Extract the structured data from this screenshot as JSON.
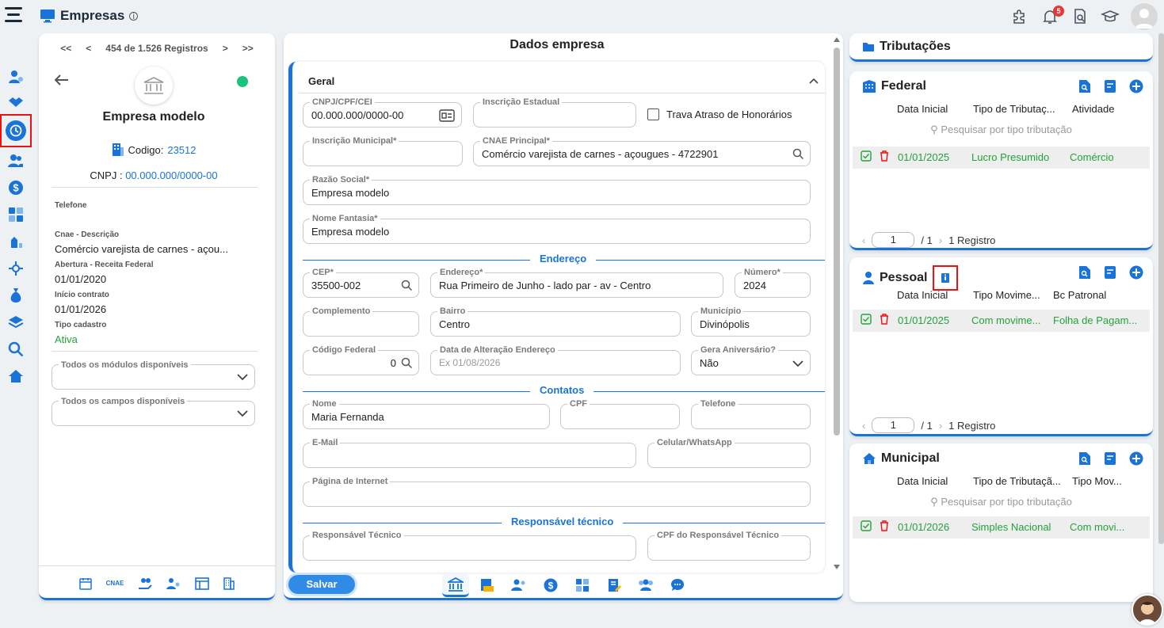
{
  "app": {
    "title": "Empresas",
    "notification_count": "5"
  },
  "left": {
    "nav": {
      "first": "<<",
      "prev": "<",
      "counter": "454 de 1.526 Registros",
      "next": ">",
      "last": ">>"
    },
    "company_name": "Empresa modelo",
    "codigo_label": "Codigo:",
    "codigo_value": "23512",
    "cnpj_label": "CNPJ :",
    "cnpj_value": "00.000.000/0000-00",
    "telefone_label": "Telefone",
    "cnae_label": "Cnae - Descrição",
    "cnae_value": "Comércio varejista de carnes - açou...",
    "abertura_label": "Abertura - Receita Federal",
    "abertura_value": "01/01/2020",
    "inicio_label": "Início contrato",
    "inicio_value": "01/01/2026",
    "tipo_label": "Tipo cadastro",
    "tipo_value": "Ativa",
    "modulos_label": "Todos os módulos disponíveis",
    "campos_label": "Todos os campos disponíveis",
    "cnae_icon_text": "CNAE"
  },
  "center": {
    "title": "Dados empresa",
    "geral": "Geral",
    "cnpj": {
      "label": "CNPJ/CPF/CEI",
      "value": "00.000.000/0000-00"
    },
    "ie": {
      "label": "Inscrição Estadual",
      "value": ""
    },
    "trava": "Trava Atraso de Honorários",
    "im": {
      "label": "Inscrição Municipal*",
      "value": ""
    },
    "cnae": {
      "label": "CNAE Principal*",
      "value": "Comércio varejista de carnes - açougues - 4722901"
    },
    "razao": {
      "label": "Razão Social*",
      "value": "Empresa modelo"
    },
    "fantasia": {
      "label": "Nome Fantasia*",
      "value": "Empresa modelo"
    },
    "endereco_sec": "Endereço",
    "cep": {
      "label": "CEP*",
      "value": "35500-002"
    },
    "endereco": {
      "label": "Endereço*",
      "value": "Rua Primeiro de Junho - lado par - av - Centro"
    },
    "numero": {
      "label": "Número*",
      "value": "2024"
    },
    "complemento": {
      "label": "Complemento",
      "value": ""
    },
    "bairro": {
      "label": "Bairro",
      "value": "Centro"
    },
    "municipio": {
      "label": "Município",
      "value": "Divinópolis"
    },
    "codfed": {
      "label": "Código Federal",
      "value": "0"
    },
    "dataalt": {
      "label": "Data de Alteração Endereço",
      "placeholder": "Ex 01/08/2026"
    },
    "aniv": {
      "label": "Gera Aniversário?",
      "value": "Não"
    },
    "contatos_sec": "Contatos",
    "nome": {
      "label": "Nome",
      "value": "Maria Fernanda"
    },
    "cpf": {
      "label": "CPF",
      "value": ""
    },
    "telefone": {
      "label": "Telefone",
      "value": ""
    },
    "email": {
      "label": "E-Mail",
      "value": ""
    },
    "celular": {
      "label": "Celular/WhatsApp",
      "value": ""
    },
    "pagina": {
      "label": "Página de Internet",
      "value": ""
    },
    "resp_sec": "Responsável técnico",
    "resp": {
      "label": "Responsável Técnico",
      "value": ""
    },
    "cpfresp": {
      "label": "CPF do Responsável Técnico",
      "value": ""
    },
    "salvar": "Salvar"
  },
  "right": {
    "title": "Tributações",
    "federal": {
      "title": "Federal",
      "cols": [
        "Data Inicial",
        "Tipo de Tributaç...",
        "Atividade"
      ],
      "search": "Pesquisar por tipo tributação",
      "row": [
        "01/01/2025",
        "Lucro Presumido",
        "Comércio"
      ],
      "page": "1",
      "total": "/ 1",
      "records": "1 Registro"
    },
    "pessoal": {
      "title": "Pessoal",
      "cols": [
        "Data Inicial",
        "Tipo Movime...",
        "Bc Patronal"
      ],
      "row": [
        "01/01/2025",
        "Com movime...",
        "Folha de Pagam..."
      ],
      "page": "1",
      "total": "/ 1",
      "records": "1 Registro"
    },
    "municipal": {
      "title": "Municipal",
      "cols": [
        "Data Inicial",
        "Tipo de Tributaçã...",
        "Tipo Mov..."
      ],
      "search": "Pesquisar por tipo tributação",
      "row": [
        "01/01/2026",
        "Simples Nacional",
        "Com movi..."
      ]
    }
  },
  "colors": {
    "accent": "#1a73d9",
    "green": "#22a33a",
    "red": "#e11111"
  }
}
